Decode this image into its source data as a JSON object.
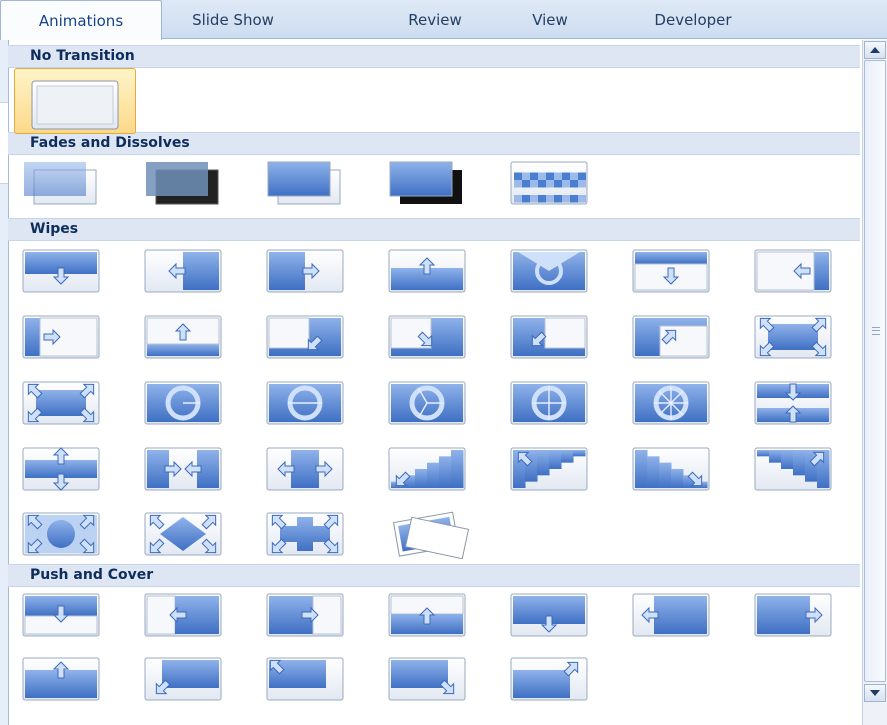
{
  "tabs": [
    {
      "label": "Animations",
      "active": true
    },
    {
      "label": "Slide Show",
      "active": false
    },
    {
      "label": "Review",
      "active": false
    },
    {
      "label": "View",
      "active": false
    },
    {
      "label": "Developer",
      "active": false
    }
  ],
  "gallery": {
    "categories": [
      {
        "title": "No Transition",
        "items": [
          {
            "name": "No Transition",
            "icon": "blank-slide",
            "selected": true
          }
        ]
      },
      {
        "title": "Fades and Dissolves",
        "items": [
          {
            "name": "Fade Smoothly",
            "icon": "fade-smooth"
          },
          {
            "name": "Fade Through Black",
            "icon": "fade-black"
          },
          {
            "name": "Cut",
            "icon": "cut"
          },
          {
            "name": "Cut Through Black",
            "icon": "cut-black"
          },
          {
            "name": "Dissolve",
            "icon": "dissolve"
          }
        ]
      },
      {
        "title": "Wipes",
        "items": [
          {
            "name": "Wipe Down",
            "icon": "wipe-down"
          },
          {
            "name": "Wipe Left",
            "icon": "wipe-left"
          },
          {
            "name": "Wipe Right",
            "icon": "wipe-right"
          },
          {
            "name": "Wipe Up",
            "icon": "wipe-up"
          },
          {
            "name": "Wedge",
            "icon": "wedge"
          },
          {
            "name": "Uncover Down",
            "icon": "uncover-down"
          },
          {
            "name": "Uncover Left",
            "icon": "uncover-left"
          },
          {
            "name": "Uncover Right",
            "icon": "uncover-right"
          },
          {
            "name": "Uncover Up",
            "icon": "uncover-up"
          },
          {
            "name": "Uncover Left-Down",
            "icon": "uncover-left-down"
          },
          {
            "name": "Uncover Left-Up",
            "icon": "uncover-left-up"
          },
          {
            "name": "Uncover Right-Down",
            "icon": "uncover-right-down"
          },
          {
            "name": "Uncover Right-Up",
            "icon": "uncover-right-up"
          },
          {
            "name": "Box In",
            "icon": "box-in"
          },
          {
            "name": "Box Out",
            "icon": "box-out"
          },
          {
            "name": "Wheel Clockwise 1 Spoke",
            "icon": "wheel-1"
          },
          {
            "name": "Wheel Clockwise 2 Spokes",
            "icon": "wheel-2"
          },
          {
            "name": "Wheel Clockwise 3 Spokes",
            "icon": "wheel-3"
          },
          {
            "name": "Wheel Clockwise 4 Spokes",
            "icon": "wheel-4"
          },
          {
            "name": "Wheel Clockwise 8 Spokes",
            "icon": "wheel-8"
          },
          {
            "name": "Split Horizontal In",
            "icon": "split-horizontal-in"
          },
          {
            "name": "Split Horizontal Out",
            "icon": "split-horizontal-out"
          },
          {
            "name": "Split Vertical In",
            "icon": "split-vertical-in"
          },
          {
            "name": "Split Vertical Out",
            "icon": "split-vertical-out"
          },
          {
            "name": "Strips Left-Down",
            "icon": "strips-left-down"
          },
          {
            "name": "Strips Left-Up",
            "icon": "strips-left-up"
          },
          {
            "name": "Strips Right-Down",
            "icon": "strips-right-down"
          },
          {
            "name": "Strips Right-Up",
            "icon": "strips-right-up"
          },
          {
            "name": "Shape Circle",
            "icon": "shape-circle"
          },
          {
            "name": "Shape Diamond",
            "icon": "shape-diamond"
          },
          {
            "name": "Shape Plus",
            "icon": "shape-plus"
          },
          {
            "name": "Newsflash",
            "icon": "newsflash"
          }
        ]
      },
      {
        "title": "Push and Cover",
        "items": [
          {
            "name": "Push Down",
            "icon": "push-down"
          },
          {
            "name": "Push Left",
            "icon": "push-left"
          },
          {
            "name": "Push Right",
            "icon": "push-right"
          },
          {
            "name": "Push Up",
            "icon": "push-up"
          },
          {
            "name": "Cover Down",
            "icon": "cover-down"
          },
          {
            "name": "Cover Left",
            "icon": "cover-left"
          },
          {
            "name": "Cover Right",
            "icon": "cover-right"
          },
          {
            "name": "Cover Up",
            "icon": "cover-up"
          },
          {
            "name": "Cover Left-Down",
            "icon": "cover-left-down"
          },
          {
            "name": "Cover Left-Up",
            "icon": "cover-left-up"
          },
          {
            "name": "Cover Right-Down",
            "icon": "cover-right-down"
          },
          {
            "name": "Cover Right-Up",
            "icon": "cover-right-up"
          }
        ]
      }
    ]
  },
  "scrollbar": {
    "up_icon": "scroll-up-arrow-icon",
    "down_icon": "scroll-down-arrow-icon"
  },
  "colors": {
    "accent_blue": "#4a7fd0",
    "selected_fill": "#fcd98a",
    "category_band": "#dde6f2"
  }
}
